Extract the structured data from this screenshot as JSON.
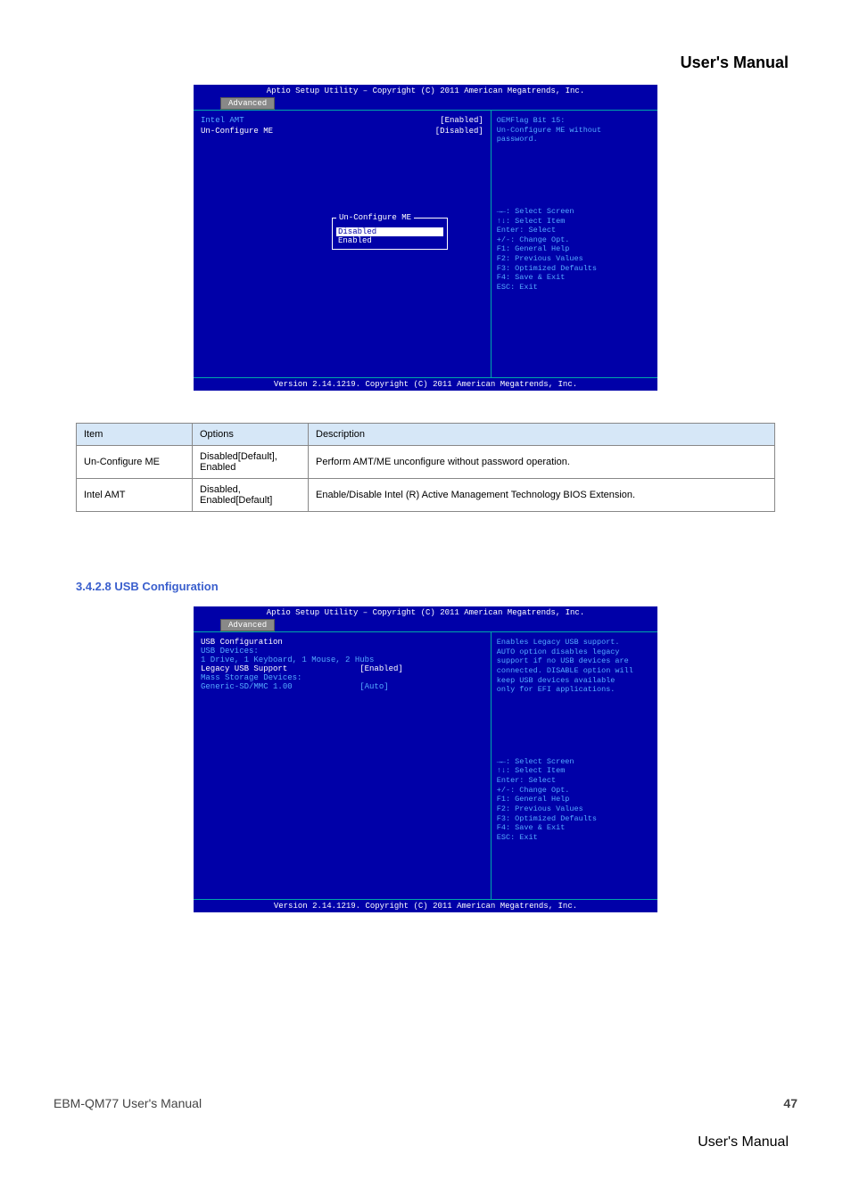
{
  "header": {
    "title": "User's  Manual"
  },
  "bios_amt": {
    "top": "Aptio Setup Utility – Copyright (C) 2011 American Megatrends, Inc.",
    "tab": "Advanced",
    "items": [
      {
        "label": "Intel AMT",
        "value": "[Enabled]"
      },
      {
        "label": "Un-Configure ME",
        "value": "[Disabled]"
      }
    ],
    "popup": {
      "title": "Un-Configure ME",
      "options": [
        "Disabled",
        "Enabled"
      ],
      "selected": 0
    },
    "help_top": "OEMFlag Bit 15:\nUn-Configure ME without\npassword.",
    "help_keys": "→←: Select Screen\n↑↓: Select Item\nEnter: Select\n+/-: Change Opt.\nF1: General Help\nF2: Previous Values\nF3: Optimized Defaults\nF4: Save & Exit\nESC: Exit",
    "footer": "Version 2.14.1219. Copyright (C) 2011 American Megatrends, Inc."
  },
  "table": {
    "headers": [
      "Item",
      "Options",
      "Description"
    ],
    "rows": [
      {
        "item": "Un-Configure ME",
        "options": "Disabled[Default],\nEnabled",
        "description": "Perform AMT/ME unconfigure without password operation."
      },
      {
        "item": "Intel AMT",
        "options": "Disabled,\nEnabled[Default]",
        "description": "Enable/Disable Intel (R) Active Management Technology BIOS Extension."
      }
    ]
  },
  "section": {
    "heading": "3.4.2.8    USB Configuration"
  },
  "bios_usb": {
    "top": "Aptio Setup Utility – Copyright (C) 2011 American Megatrends, Inc.",
    "tab": "Advanced",
    "lines": [
      "USB Configuration",
      "",
      "USB Devices:",
      "    1 Drive, 1 Keyboard, 1 Mouse, 2 Hubs",
      "",
      "Legacy USB Support               [Enabled]",
      "",
      "",
      "Mass Storage Devices:",
      "Generic-SD/MMC 1.00              [Auto]"
    ],
    "help_top": "Enables Legacy USB support.\nAUTO option disables legacy\nsupport if no USB devices are\nconnected. DISABLE option will\nkeep USB devices available\nonly for EFI applications.",
    "help_keys": "→←: Select Screen\n↑↓: Select Item\nEnter: Select\n+/-: Change Opt.\nF1: General Help\nF2: Previous Values\nF3: Optimized Defaults\nF4: Save & Exit\nESC: Exit",
    "footer": "Version 2.14.1219. Copyright (C) 2011 American Megatrends, Inc."
  },
  "footer": {
    "left": "EBM-QM77 User's Manual",
    "right": "47"
  },
  "page_label": "User's  Manual"
}
